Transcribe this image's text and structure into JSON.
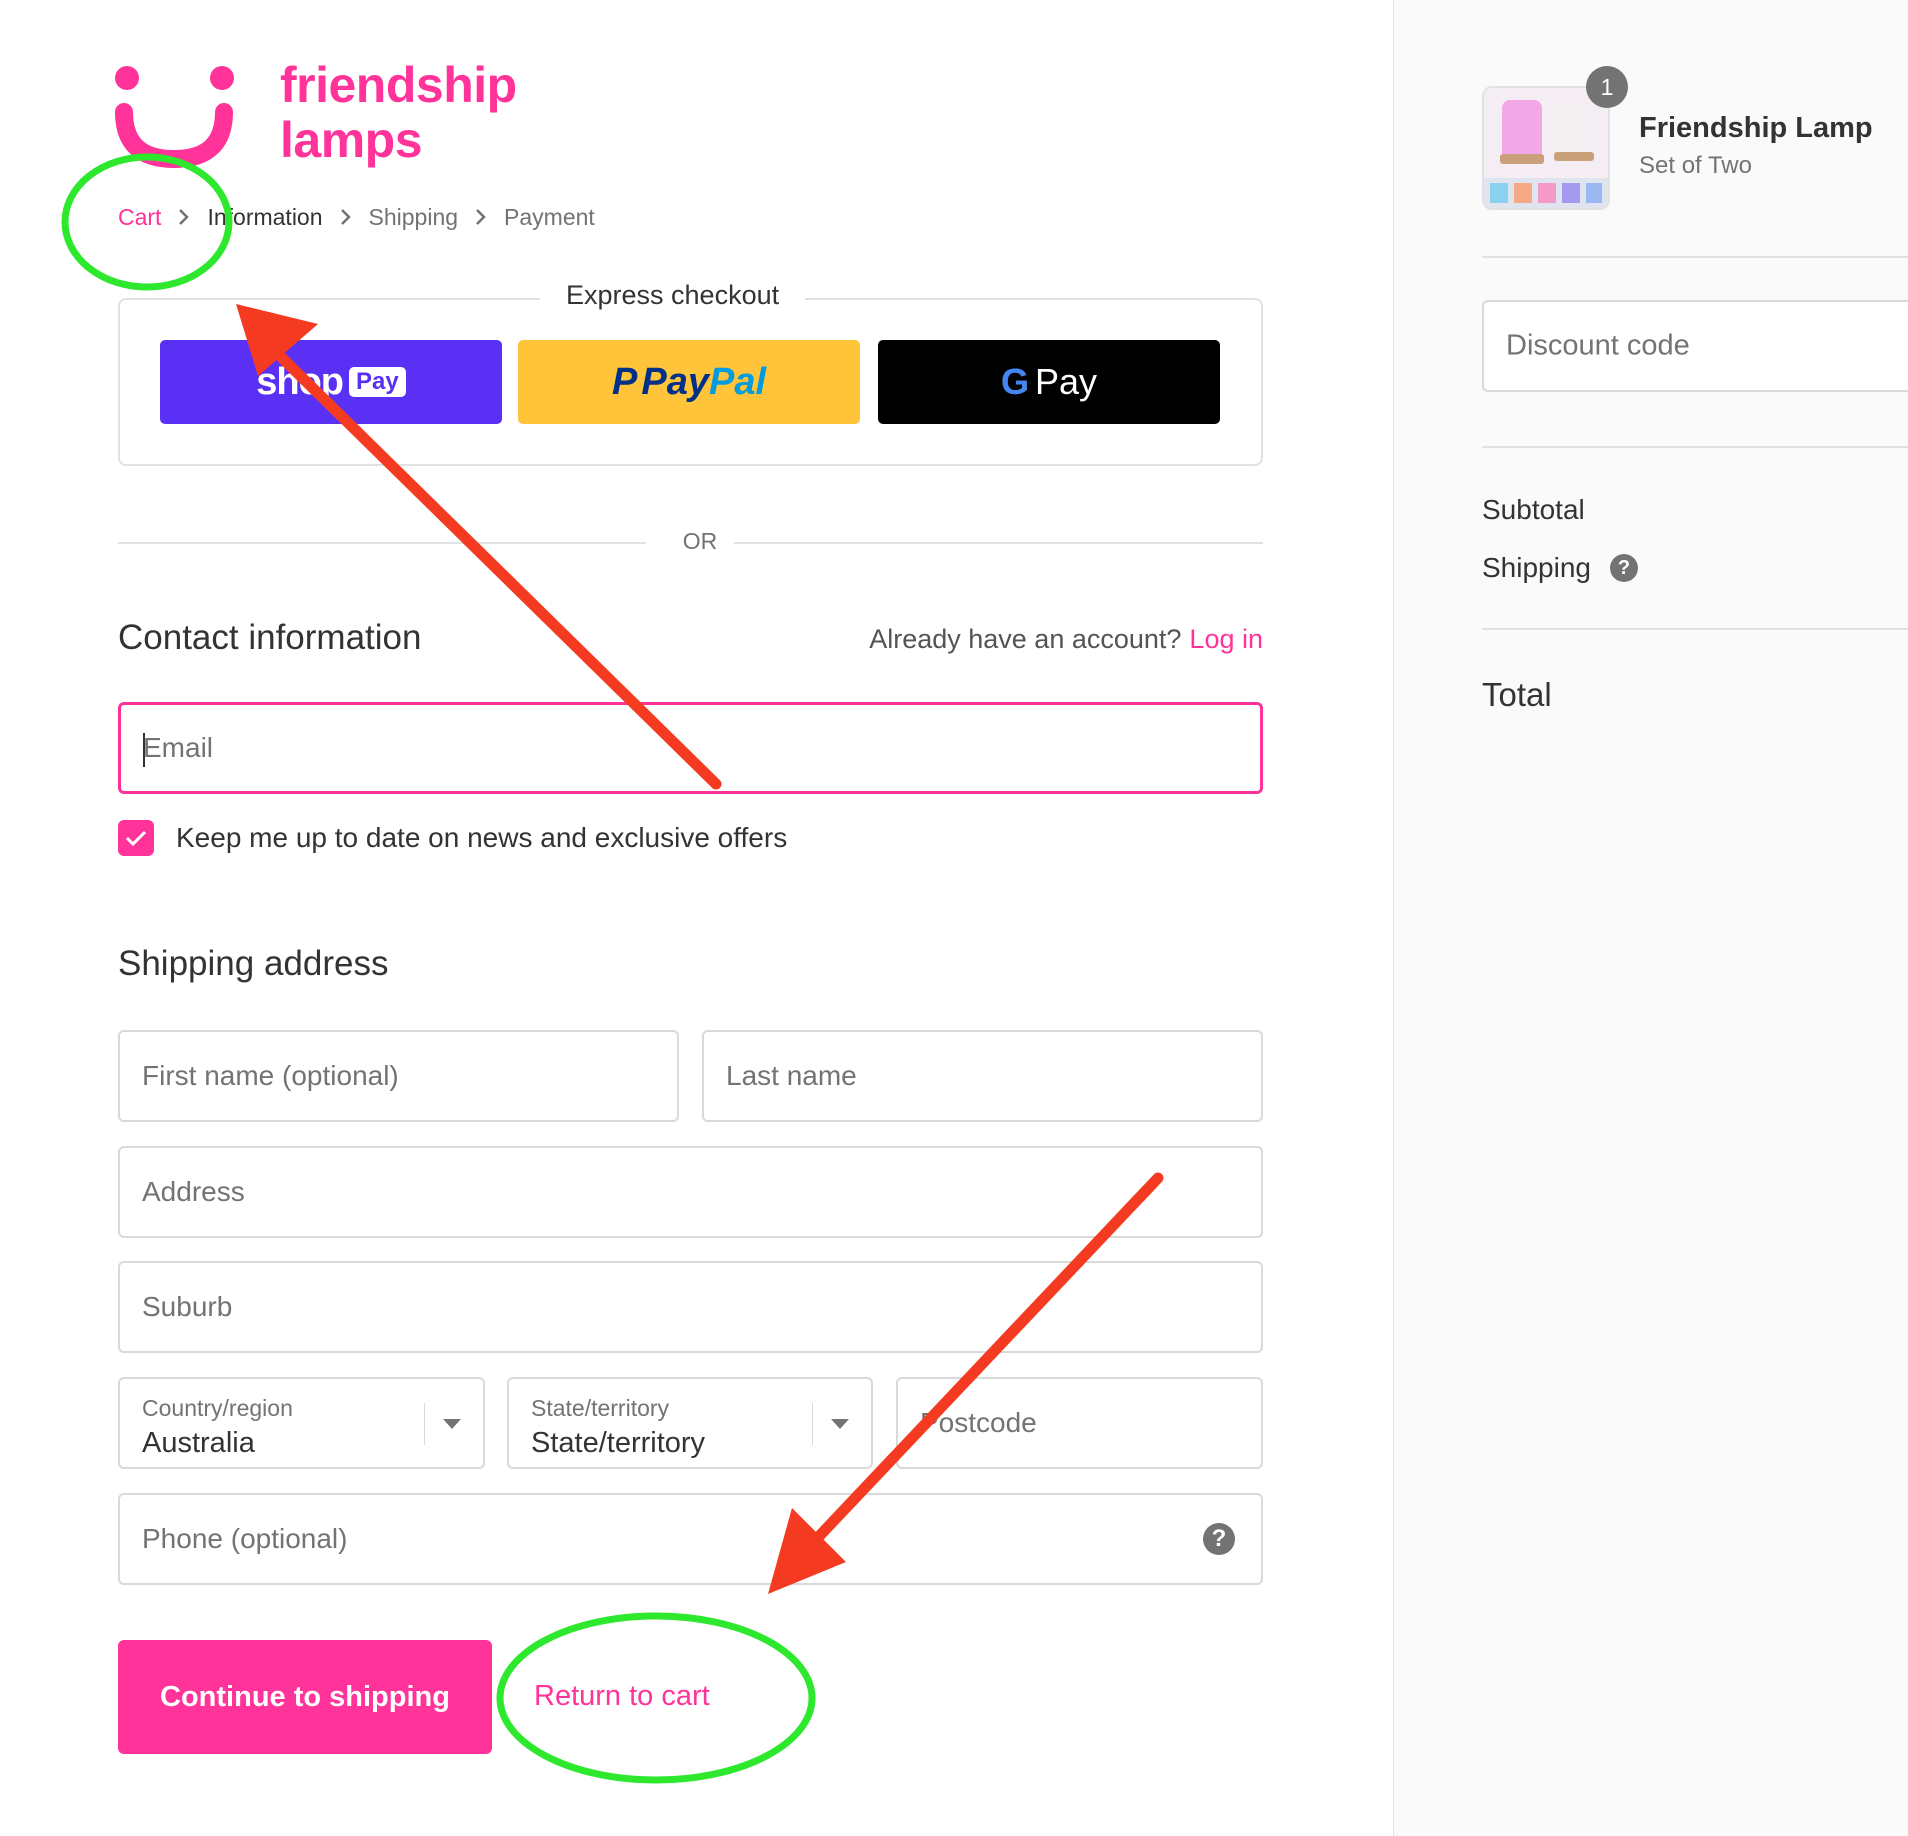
{
  "logo": {
    "line1": "friendship",
    "line2": "lamps"
  },
  "breadcrumb": {
    "cart": "Cart",
    "information": "Information",
    "shipping": "Shipping",
    "payment": "Payment"
  },
  "express": {
    "title": "Express checkout",
    "shop_pay": {
      "word": "shop",
      "tag": "Pay"
    },
    "paypal": {
      "part1": "Pay",
      "part2": "Pal"
    },
    "gpay": {
      "g": "G",
      "word": "Pay"
    }
  },
  "divider": "OR",
  "contact": {
    "title": "Contact information",
    "account_prompt": "Already have an account?",
    "login_link": "Log in",
    "email_placeholder": "Email",
    "newsletter_label": "Keep me up to date on news and exclusive offers",
    "newsletter_checked": true
  },
  "shipping_address": {
    "title": "Shipping address",
    "first_name_placeholder": "First name (optional)",
    "last_name_placeholder": "Last name",
    "address_placeholder": "Address",
    "suburb_placeholder": "Suburb",
    "country": {
      "label": "Country/region",
      "value": "Australia"
    },
    "state": {
      "label": "State/territory",
      "value": "State/territory"
    },
    "postcode_placeholder": "Postcode",
    "phone_placeholder": "Phone (optional)"
  },
  "actions": {
    "continue": "Continue to shipping",
    "return": "Return to cart"
  },
  "summary": {
    "quantity": "1",
    "product_name": "Friendship Lamp",
    "product_variant": "Set of Two",
    "discount_placeholder": "Discount code",
    "subtotal_label": "Subtotal",
    "shipping_label": "Shipping",
    "total_label": "Total"
  },
  "colors": {
    "brand_pink": "#ff3399",
    "shop_pay": "#5a31f4",
    "paypal": "#ffc439",
    "annotation_circle": "#2ee82e",
    "annotation_arrow": "#f53a22"
  },
  "icons": [
    "chevron-right-icon",
    "check-icon",
    "help-icon",
    "dropdown-arrow-icon",
    "smile-logo-icon"
  ]
}
